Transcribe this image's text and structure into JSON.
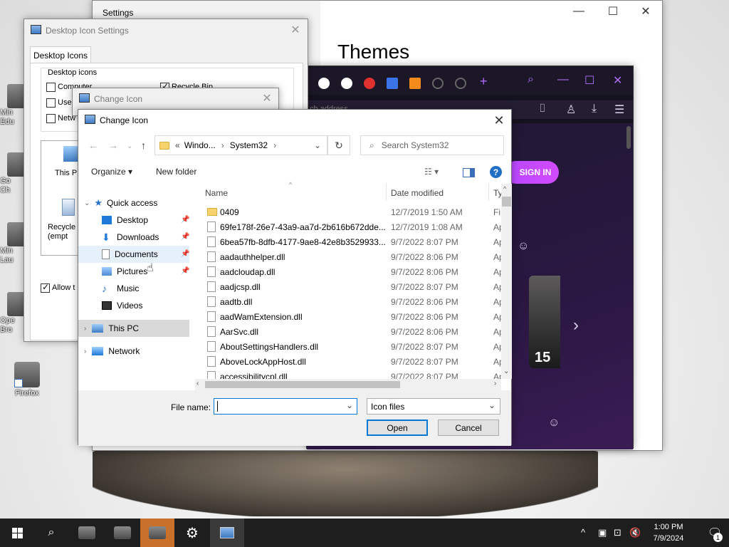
{
  "desktop": {
    "icons": [
      {
        "label": "Firefox"
      }
    ],
    "partial_icons": [
      {
        "label": "Min\nEdu"
      },
      {
        "label": "Go\nCh"
      },
      {
        "label": "Min\nLau"
      },
      {
        "label": "Ope\nBro"
      }
    ]
  },
  "settings": {
    "title": "Settings",
    "heading": "Themes",
    "minimize": "—",
    "maximize": "☐",
    "close": "✕"
  },
  "browser": {
    "address_placeholder": "ch address",
    "sign_in": "SIGN IN",
    "card_number": "15"
  },
  "desktop_icon_settings": {
    "title": "Desktop Icon Settings",
    "tab": "Desktop Icons",
    "group_label": "Desktop icons",
    "checkbox_computer": "Computer",
    "checkbox_recycle": "Recycle Bin",
    "checkbox_user": "User",
    "checkbox_network": "Netw",
    "preview_this_pc": "This P",
    "preview_recycle": "Recycle\n(empt",
    "allow_label": "Allow t"
  },
  "change_icon_back": {
    "title": "Change Icon"
  },
  "dialog": {
    "title": "Change Icon",
    "path_prefix": "«",
    "path_1": "Windo...",
    "path_2": "System32",
    "search_placeholder": "Search System32",
    "organize": "Organize",
    "new_folder": "New folder",
    "help": "?",
    "nav": {
      "quick_access": "Quick access",
      "desktop": "Desktop",
      "downloads": "Downloads",
      "documents": "Documents",
      "pictures": "Pictures",
      "music": "Music",
      "videos": "Videos",
      "this_pc": "This PC",
      "network": "Network"
    },
    "columns": {
      "name": "Name",
      "date": "Date modified",
      "type": "Ty"
    },
    "files": [
      {
        "name": "0409",
        "date": "12/7/2019 1:50 AM",
        "type": "Fi",
        "folder": true
      },
      {
        "name": "69fe178f-26e7-43a9-aa7d-2b616b672dde...",
        "date": "12/7/2019 1:08 AM",
        "type": "Ap",
        "folder": false
      },
      {
        "name": "6bea57fb-8dfb-4177-9ae8-42e8b3529933...",
        "date": "9/7/2022 8:07 PM",
        "type": "Ap",
        "folder": false
      },
      {
        "name": "aadauthhelper.dll",
        "date": "9/7/2022 8:06 PM",
        "type": "Ap",
        "folder": false
      },
      {
        "name": "aadcloudap.dll",
        "date": "9/7/2022 8:06 PM",
        "type": "Ap",
        "folder": false
      },
      {
        "name": "aadjcsp.dll",
        "date": "9/7/2022 8:07 PM",
        "type": "Ap",
        "folder": false
      },
      {
        "name": "aadtb.dll",
        "date": "9/7/2022 8:06 PM",
        "type": "Ap",
        "folder": false
      },
      {
        "name": "aadWamExtension.dll",
        "date": "9/7/2022 8:06 PM",
        "type": "Ap",
        "folder": false
      },
      {
        "name": "AarSvc.dll",
        "date": "9/7/2022 8:06 PM",
        "type": "Ap",
        "folder": false
      },
      {
        "name": "AboutSettingsHandlers.dll",
        "date": "9/7/2022 8:07 PM",
        "type": "Ap",
        "folder": false
      },
      {
        "name": "AboveLockAppHost.dll",
        "date": "9/7/2022 8:07 PM",
        "type": "Ap",
        "folder": false
      },
      {
        "name": "accessibilitycpl.dll",
        "date": "9/7/2022 8:07 PM",
        "type": "Ap",
        "folder": false
      }
    ],
    "file_name_label": "File name:",
    "file_name_value": "",
    "file_type": "Icon files",
    "open": "Open",
    "cancel": "Cancel"
  },
  "taskbar": {
    "time": "1:00 PM",
    "date": "7/9/2024",
    "notification_count": "1"
  },
  "colors": {
    "accent": "#0078d7",
    "browser_bg": "#15121f",
    "sign_in": "#c24bff",
    "taskbar": "#1e1e1e"
  }
}
